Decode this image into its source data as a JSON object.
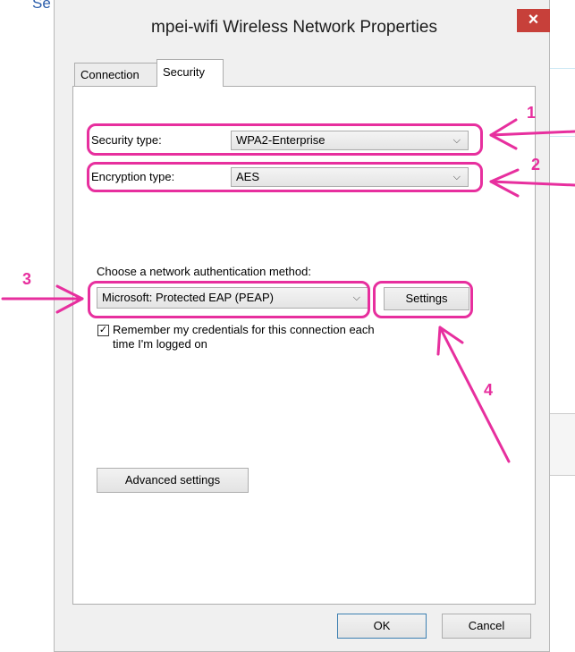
{
  "dialog": {
    "title": "mpei-wifi Wireless Network Properties",
    "close_symbol": "×"
  },
  "tabs": [
    {
      "label": "Connection"
    },
    {
      "label": "Security"
    }
  ],
  "security": {
    "security_type_label": "Security type:",
    "security_type_value": "WPA2-Enterprise",
    "encryption_type_label": "Encryption type:",
    "encryption_type_value": "AES",
    "auth_method_label": "Choose a network authentication method:",
    "auth_method_value": "Microsoft: Protected EAP (PEAP)",
    "settings_label": "Settings",
    "remember_label_line1": "Remember my credentials for this connection each",
    "remember_label_line2": "time I'm logged on",
    "remember_checked": true,
    "advanced_label": "Advanced settings"
  },
  "footer": {
    "ok_label": "OK",
    "cancel_label": "Cancel"
  },
  "annotations": {
    "numbers": [
      "1",
      "2",
      "3",
      "4"
    ],
    "color": "#e72f9e"
  },
  "background": {
    "fragment_text": "Se"
  }
}
